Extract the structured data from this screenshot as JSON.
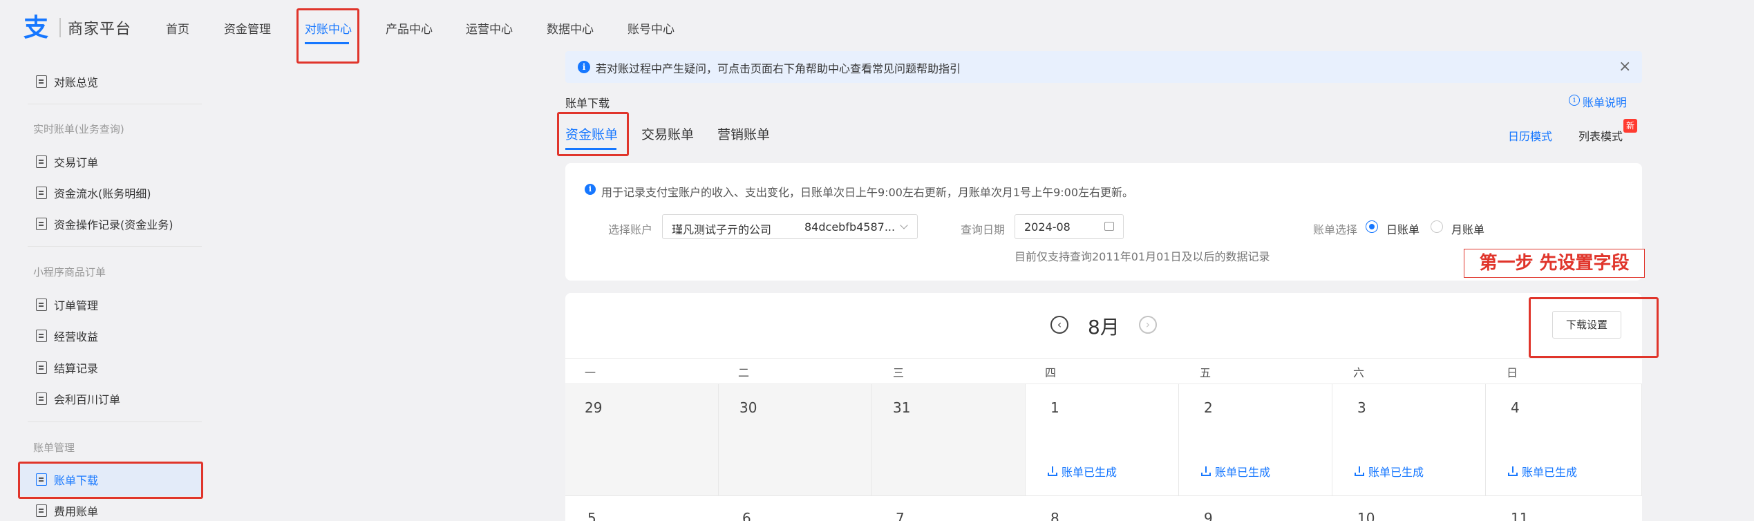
{
  "brand": {
    "logo_glyph": "支",
    "platform_name": "商家平台",
    "accent": "#1677ff"
  },
  "nav": {
    "items": [
      {
        "label": "首页"
      },
      {
        "label": "资金管理"
      },
      {
        "label": "对账中心",
        "active": true
      },
      {
        "label": "产品中心"
      },
      {
        "label": "运营中心"
      },
      {
        "label": "数据中心"
      },
      {
        "label": "账号中心"
      }
    ]
  },
  "sidebar": {
    "overview": "对账总览",
    "group_realtime": "实时账单(业务查询)",
    "realtime_items": [
      "交易订单",
      "资金流水(账务明细)",
      "资金操作记录(资金业务)"
    ],
    "group_mini": "小程序商品订单",
    "mini_items": [
      "订单管理",
      "经营收益",
      "结算记录",
      "会利百川订单"
    ],
    "group_bill": "账单管理",
    "bill_items": [
      "账单下载",
      "费用账单"
    ],
    "active_item": "账单下载"
  },
  "notice": {
    "text": "若对账过程中产生疑问，可点击页面右下角帮助中心查看常见问题帮助指引",
    "close_icon": "close-icon"
  },
  "page": {
    "section_title": "账单下载",
    "help_link": "账单说明",
    "tabs": [
      "资金账单",
      "交易账单",
      "营销账单"
    ],
    "active_tab": "资金账单",
    "view_modes": [
      "日历模式",
      "列表模式"
    ],
    "new_badge": "新"
  },
  "filter": {
    "description": "用于记录支付宝账户的收入、支出变化，日账单次日上午9:00左右更新，月账单次月1号上午9:00左右更新。",
    "account_label": "选择账户",
    "account_name": "瑾凡测试子亓的公司",
    "account_id": "84dcebfb4587...",
    "date_label": "查询日期",
    "date_value": "2024-08",
    "date_hint": "目前仅支持查询2011年01月01日及以后的数据记录",
    "bill_type_label": "账单选择",
    "bill_types": [
      {
        "label": "日账单",
        "selected": true
      },
      {
        "label": "月账单",
        "selected": false
      }
    ]
  },
  "annotation": {
    "step_text": "第一步  先设置字段",
    "color": "#e0352b"
  },
  "calendar": {
    "month": "8月",
    "download_settings": "下载设置",
    "weekdays": [
      "一",
      "二",
      "三",
      "四",
      "五",
      "六",
      "日"
    ],
    "row1": [
      {
        "day": "29",
        "status": ""
      },
      {
        "day": "30",
        "status": ""
      },
      {
        "day": "31",
        "status": ""
      },
      {
        "day": "1",
        "status": "账单已生成"
      },
      {
        "day": "2",
        "status": "账单已生成"
      },
      {
        "day": "3",
        "status": "账单已生成"
      },
      {
        "day": "4",
        "status": "账单已生成"
      }
    ],
    "row2": [
      "5",
      "6",
      "7",
      "8",
      "9",
      "10",
      "11"
    ]
  }
}
